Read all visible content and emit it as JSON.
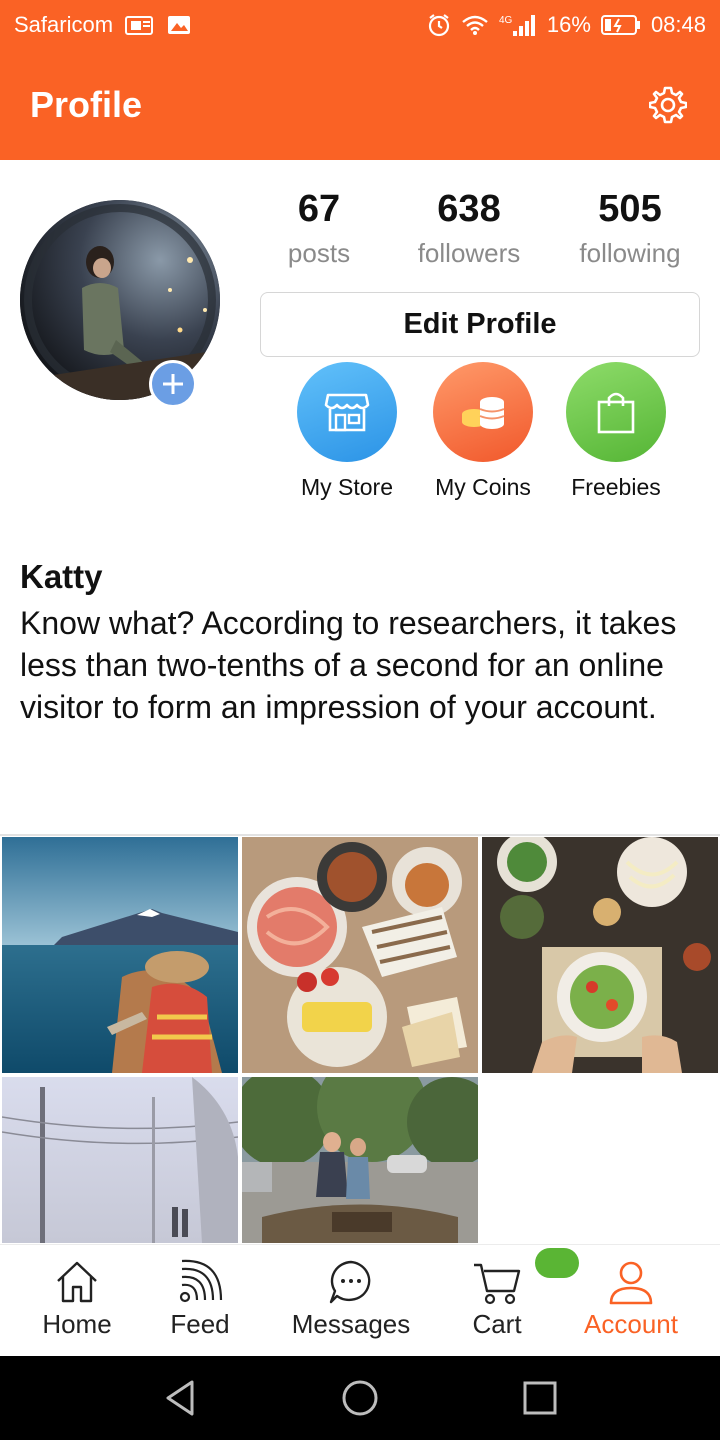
{
  "status_bar": {
    "carrier": "Safaricom",
    "network_label": "4G",
    "battery": "16%",
    "time": "08:48",
    "icons": [
      "sim-card-icon",
      "image-icon",
      "alarm-icon",
      "wifi-icon",
      "signal-icon",
      "battery-icon"
    ]
  },
  "app_bar": {
    "title": "Profile",
    "settings_icon": "gear-icon"
  },
  "profile": {
    "avatar_icon": "avatar",
    "add_photo_icon": "plus-icon",
    "stats": [
      {
        "value": "67",
        "label": "posts"
      },
      {
        "value": "638",
        "label": "followers"
      },
      {
        "value": "505",
        "label": "following"
      }
    ],
    "edit_profile_label": "Edit Profile",
    "quick_actions": [
      {
        "label": "My Store",
        "icon": "store-icon",
        "color": "#2b93e6"
      },
      {
        "label": "My Coins",
        "icon": "coins-icon",
        "color": "#f1582b"
      },
      {
        "label": "Freebies",
        "icon": "shopping-bag-icon",
        "color": "#55b535"
      }
    ],
    "name": "Katty",
    "bio": "Know what? According to researchers, it takes less than two-tenths of a second for an online visitor to form an impression of your account."
  },
  "posts": [
    {
      "subject": "woman on boat by lake and mountain"
    },
    {
      "subject": "table of food plates"
    },
    {
      "subject": "salad bowls and noodles"
    },
    {
      "subject": "foggy street with power lines"
    },
    {
      "subject": "couple walking in park"
    }
  ],
  "bottom_nav": {
    "items": [
      {
        "label": "Home",
        "icon": "home-icon",
        "active": false
      },
      {
        "label": "Feed",
        "icon": "feed-icon",
        "active": false
      },
      {
        "label": "Messages",
        "icon": "chat-bubble-icon",
        "active": false
      },
      {
        "label": "Cart",
        "icon": "cart-icon",
        "active": false
      },
      {
        "label": "Account",
        "icon": "user-icon",
        "active": true
      }
    ],
    "active_color": "#fa6225",
    "cart_badge_color": "#5ab534"
  },
  "system_nav": {
    "icons": [
      "back-icon",
      "home-circle-icon",
      "recents-icon"
    ]
  },
  "theme": {
    "brand": "#fa6225"
  }
}
